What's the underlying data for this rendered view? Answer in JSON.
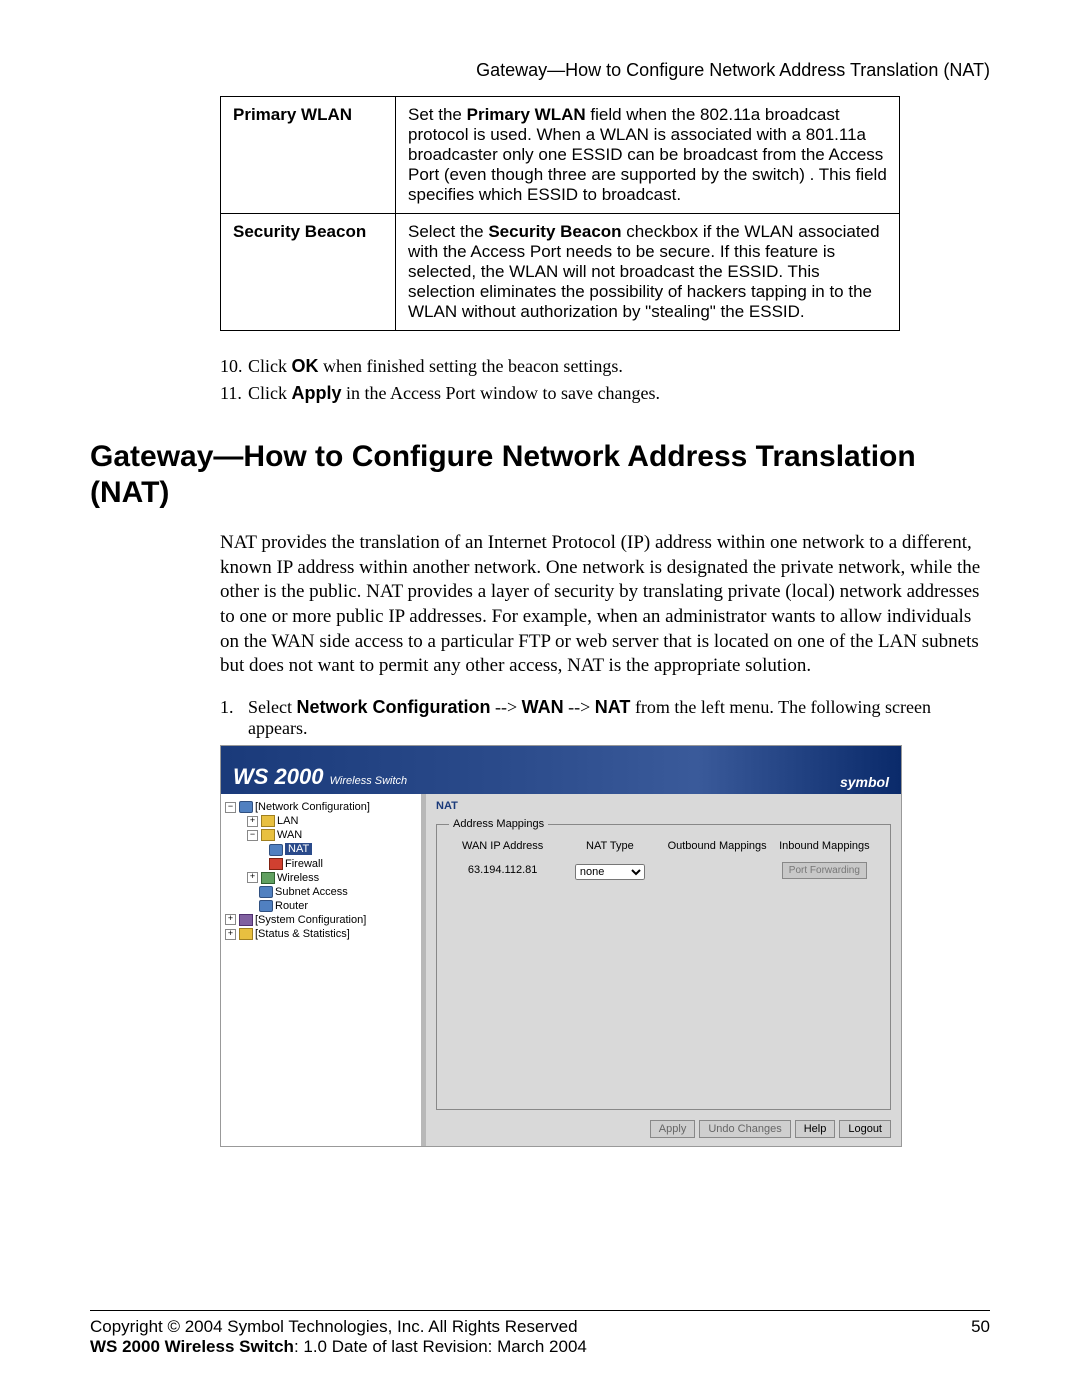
{
  "run_head": "Gateway—How to Configure Network Address Translation (NAT)",
  "table": {
    "r1k": "Primary WLAN",
    "r1v_pre": "Set the ",
    "r1v_b": "Primary WLAN",
    "r1v_post": " field when the 802.11a broadcast protocol is used. When a WLAN is associated with a 801.11a broadcaster only one ESSID can be broadcast from the Access Port (even though three are supported by the switch) . This field specifies which ESSID to broadcast.",
    "r2k": "Security Beacon",
    "r2v_pre": "Select the ",
    "r2v_b": "Security Beacon",
    "r2v_post": " checkbox if the WLAN associated with the Access Port needs to be secure. If this feature is selected, the WLAN will not broadcast the ESSID. This selection eliminates the possibility of hackers tapping in to the WLAN without authorization by \"stealing\" the ESSID."
  },
  "steps_a": {
    "n10": "10.",
    "t10a": "Click ",
    "t10b": "OK",
    "t10c": " when finished setting the beacon settings.",
    "n11": "11.",
    "t11a": "Click ",
    "t11b": "Apply",
    "t11c": " in the Access Port window to save changes."
  },
  "h1": "Gateway—How to Configure Network Address Translation (NAT)",
  "para": "NAT provides the translation of an Internet Protocol (IP) address within one network to a different, known IP address within another network. One network is designated the private network, while the other is the public. NAT provides a layer of security by translating private (local) network addresses to one or more public IP addresses. For example, when an administrator wants to allow individuals on the WAN side access to a particular FTP or web server that is located on one of the LAN subnets but does not want to permit any other access, NAT is the appropriate solution.",
  "step1": {
    "n": "1.",
    "a": "Select ",
    "b1": "Network Configuration",
    "s1": " --> ",
    "b2": "WAN",
    "s2": " --> ",
    "b3": "NAT",
    "c": " from the left menu. The following screen appears."
  },
  "shot": {
    "brand": "WS 2000",
    "brand_sub": "Wireless Switch",
    "logo": "symbol",
    "tree": {
      "netcfg": "[Network Configuration]",
      "lan": "LAN",
      "wan": "WAN",
      "nat": "NAT",
      "fw": "Firewall",
      "wl": "Wireless",
      "sa": "Subnet Access",
      "rt": "Router",
      "syscfg": "[System Configuration]",
      "stat": "[Status & Statistics]"
    },
    "panel_title": "NAT",
    "legend": "Address Mappings",
    "cols": {
      "c1": "WAN IP Address",
      "c2": "NAT Type",
      "c3": "Outbound Mappings",
      "c4": "Inbound Mappings"
    },
    "ip": "63.194.112.81",
    "natopt": "none",
    "pf": "Port Forwarding",
    "btn_apply": "Apply",
    "btn_undo": "Undo Changes",
    "btn_help": "Help",
    "btn_logout": "Logout"
  },
  "footer": {
    "copy": "Copyright © 2004 Symbol Technologies, Inc. All Rights Reserved",
    "page": "50",
    "line2a": "WS 2000 Wireless Switch",
    "line2b": ": 1.0  Date of last Revision: March 2004"
  }
}
